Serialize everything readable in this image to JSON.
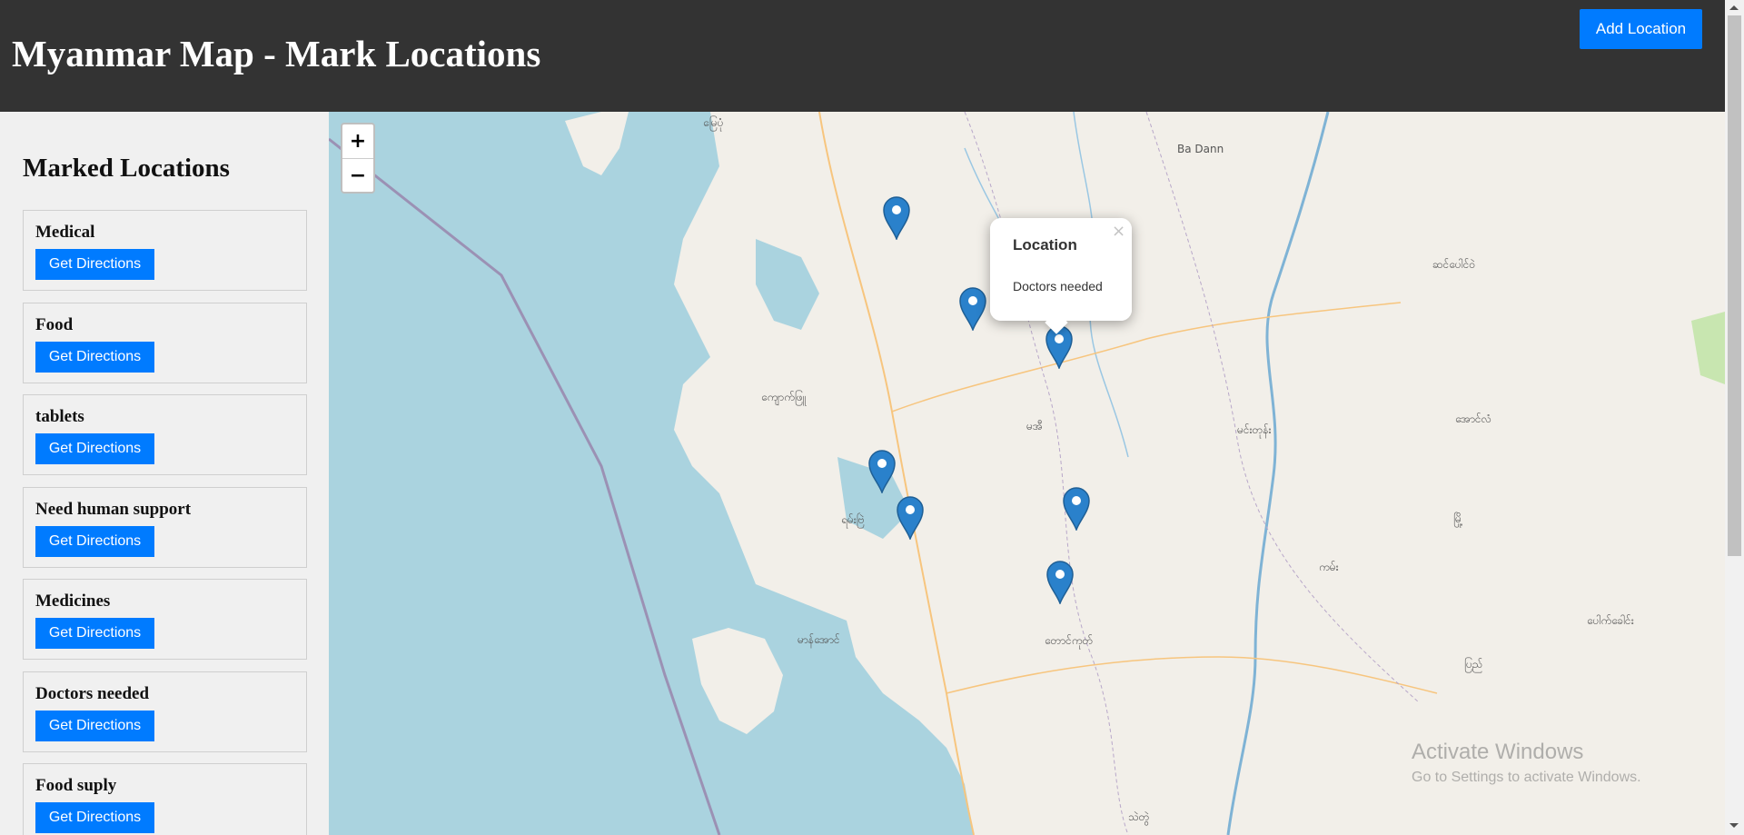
{
  "header": {
    "title": "Myanmar Map - Mark Locations",
    "add_button_label": "Add Location"
  },
  "sidebar": {
    "title": "Marked Locations",
    "items": [
      {
        "name": "Medical",
        "button_label": "Get Directions"
      },
      {
        "name": "Food",
        "button_label": "Get Directions"
      },
      {
        "name": "tablets",
        "button_label": "Get Directions"
      },
      {
        "name": "Need human support",
        "button_label": "Get Directions"
      },
      {
        "name": "Medicines",
        "button_label": "Get Directions"
      },
      {
        "name": "Doctors needed",
        "button_label": "Get Directions"
      },
      {
        "name": "Food suply",
        "button_label": "Get Directions"
      }
    ]
  },
  "map": {
    "zoom_in_label": "+",
    "zoom_out_label": "−",
    "popup": {
      "title": "Location",
      "text": "Doctors needed",
      "close_label": "×"
    },
    "labels": {
      "ba_dann": "Ba Dann",
      "l1": "မြေပုံ",
      "l2": "ကျောက်ဖြူ",
      "l3": "ရမ်းဗြဲ",
      "l4": "မာန်အောင်",
      "l5": "တောင်ကုတ်",
      "l6": "မင်းတုန်း",
      "l7": "အောင်လံ",
      "l8": "ပြည်",
      "l9": "ဆင်ပေါင်ဝဲ",
      "l10": "ပေါက်ခေါင်း",
      "l11": "သဲတွဲ",
      "l12": "မအီ",
      "l13": "ကမ်း",
      "l14": "မြို့"
    },
    "colors": {
      "water": "#aad3df",
      "land": "#f2efe9",
      "marker": "#2a81cb",
      "primary_button": "#007bff"
    }
  },
  "watermark": {
    "line1": "Activate Windows",
    "line2": "Go to Settings to activate Windows."
  }
}
